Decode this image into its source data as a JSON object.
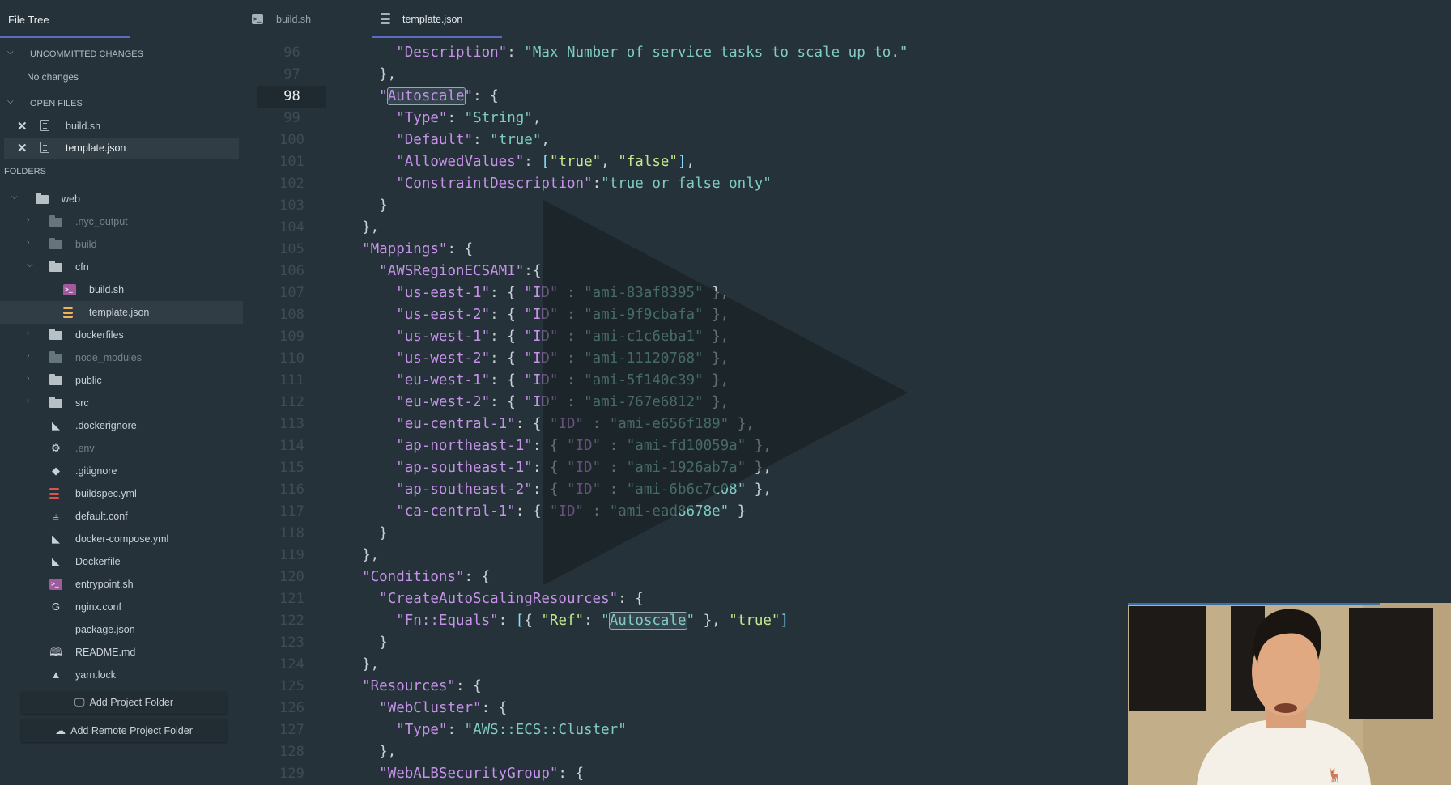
{
  "sidebar": {
    "title": "File Tree",
    "uncommitted": {
      "label": "UNCOMMITTED CHANGES",
      "status": "No changes"
    },
    "open_files": {
      "label": "OPEN FILES",
      "items": [
        {
          "name": "build.sh",
          "active": false
        },
        {
          "name": "template.json",
          "active": true
        }
      ]
    },
    "folders_label": "FOLDERS",
    "tree": [
      {
        "name": "web",
        "type": "project-folder",
        "expanded": true,
        "depth": 0
      },
      {
        "name": ".nyc_output",
        "type": "folder",
        "expanded": false,
        "depth": 1,
        "dim": true
      },
      {
        "name": "build",
        "type": "folder",
        "expanded": false,
        "depth": 1,
        "dim": true
      },
      {
        "name": "cfn",
        "type": "folder",
        "expanded": true,
        "depth": 1
      },
      {
        "name": "build.sh",
        "type": "shell-file",
        "depth": 2
      },
      {
        "name": "template.json",
        "type": "json-file",
        "depth": 2,
        "selected": true
      },
      {
        "name": "dockerfiles",
        "type": "folder",
        "expanded": false,
        "depth": 1
      },
      {
        "name": "node_modules",
        "type": "folder",
        "expanded": false,
        "depth": 1,
        "dim": true
      },
      {
        "name": "public",
        "type": "folder",
        "expanded": false,
        "depth": 1
      },
      {
        "name": "src",
        "type": "folder",
        "expanded": false,
        "depth": 1
      },
      {
        "name": ".dockerignore",
        "type": "docker-file",
        "depth": 1
      },
      {
        "name": ".env",
        "type": "settings-file",
        "depth": 1,
        "dim": true
      },
      {
        "name": ".gitignore",
        "type": "git-file",
        "depth": 1
      },
      {
        "name": "buildspec.yml",
        "type": "database-file",
        "depth": 1
      },
      {
        "name": "default.conf",
        "type": "config-file",
        "depth": 1
      },
      {
        "name": "docker-compose.yml",
        "type": "docker-file",
        "depth": 1
      },
      {
        "name": "Dockerfile",
        "type": "docker-file",
        "depth": 1
      },
      {
        "name": "entrypoint.sh",
        "type": "shell-file",
        "depth": 1
      },
      {
        "name": "nginx.conf",
        "type": "nginx-file",
        "depth": 1
      },
      {
        "name": "package.json",
        "type": "npm-file",
        "depth": 1
      },
      {
        "name": "README.md",
        "type": "readme-file",
        "depth": 1
      },
      {
        "name": "yarn.lock",
        "type": "yarn-file",
        "depth": 1
      }
    ],
    "buttons": {
      "add_project_folder": "Add Project Folder",
      "add_remote_project_folder": "Add Remote Project Folder"
    }
  },
  "tabs": [
    {
      "label": "build.sh",
      "icon": "terminal-icon",
      "active": false
    },
    {
      "label": "template.json",
      "icon": "database-icon",
      "active": true
    }
  ],
  "editor": {
    "current_line": 98,
    "highlight_word": "Autoscale",
    "lines": [
      {
        "n": "96",
        "text": "    \"Description\": \"Max Number of service tasks to scale up to.\""
      },
      {
        "n": "97",
        "text": "  },"
      },
      {
        "n": "98",
        "text": "  \"Autoscale\": {"
      },
      {
        "n": "99",
        "text": "    \"Type\": \"String\","
      },
      {
        "n": "100",
        "text": "    \"Default\": \"true\","
      },
      {
        "n": "101",
        "text": "    \"AllowedValues\": [\"true\", \"false\"],"
      },
      {
        "n": "102",
        "text": "    \"ConstraintDescription\":\"true or false only\""
      },
      {
        "n": "103",
        "text": "  }"
      },
      {
        "n": "104",
        "text": "},"
      },
      {
        "n": "105",
        "text": "\"Mappings\": {"
      },
      {
        "n": "106",
        "text": "  \"AWSRegionECSAMI\":{"
      },
      {
        "n": "107",
        "text": "    \"us-east-1\": { \"ID\" : \"ami-83af8395\" },"
      },
      {
        "n": "108",
        "text": "    \"us-east-2\": { \"ID\" : \"ami-9f9cbafa\" },"
      },
      {
        "n": "109",
        "text": "    \"us-west-1\": { \"ID\" : \"ami-c1c6eba1\" },"
      },
      {
        "n": "110",
        "text": "    \"us-west-2\": { \"ID\" : \"ami-11120768\" },"
      },
      {
        "n": "111",
        "text": "    \"eu-west-1\": { \"ID\" : \"ami-5f140c39\" },"
      },
      {
        "n": "112",
        "text": "    \"eu-west-2\": { \"ID\" : \"ami-767e6812\" },"
      },
      {
        "n": "113",
        "text": "    \"eu-central-1\": { \"ID\" : \"ami-e656f189\" },"
      },
      {
        "n": "114",
        "text": "    \"ap-northeast-1\": { \"ID\" : \"ami-fd10059a\" },"
      },
      {
        "n": "115",
        "text": "    \"ap-southeast-1\": { \"ID\" : \"ami-1926ab7a\" },"
      },
      {
        "n": "116",
        "text": "    \"ap-southeast-2\": { \"ID\" : \"ami-6b6c7c08\" },"
      },
      {
        "n": "117",
        "text": "    \"ca-central-1\": { \"ID\" : \"ami-ead8678e\" }"
      },
      {
        "n": "118",
        "text": "  }"
      },
      {
        "n": "119",
        "text": "},"
      },
      {
        "n": "120",
        "text": "\"Conditions\": {"
      },
      {
        "n": "121",
        "text": "  \"CreateAutoScalingResources\": {"
      },
      {
        "n": "122",
        "text": "    \"Fn::Equals\": [{ \"Ref\": \"Autoscale\" }, \"true\"]"
      },
      {
        "n": "123",
        "text": "  }"
      },
      {
        "n": "124",
        "text": "},"
      },
      {
        "n": "125",
        "text": "\"Resources\": {"
      },
      {
        "n": "126",
        "text": "  \"WebCluster\": {"
      },
      {
        "n": "127",
        "text": "    \"Type\": \"AWS::ECS::Cluster\""
      },
      {
        "n": "128",
        "text": "  },"
      },
      {
        "n": "129",
        "text": "  \"WebALBSecurityGroup\": {"
      }
    ]
  },
  "video": {
    "play_icon": "play-icon",
    "webcam_label": "presenter webcam",
    "progress_fraction": 0.78
  },
  "colors": {
    "background": "#253239",
    "accent": "#5c6bc0",
    "key": "#c792ea",
    "string": "#80cbc4",
    "string_alt": "#c3e88d"
  }
}
